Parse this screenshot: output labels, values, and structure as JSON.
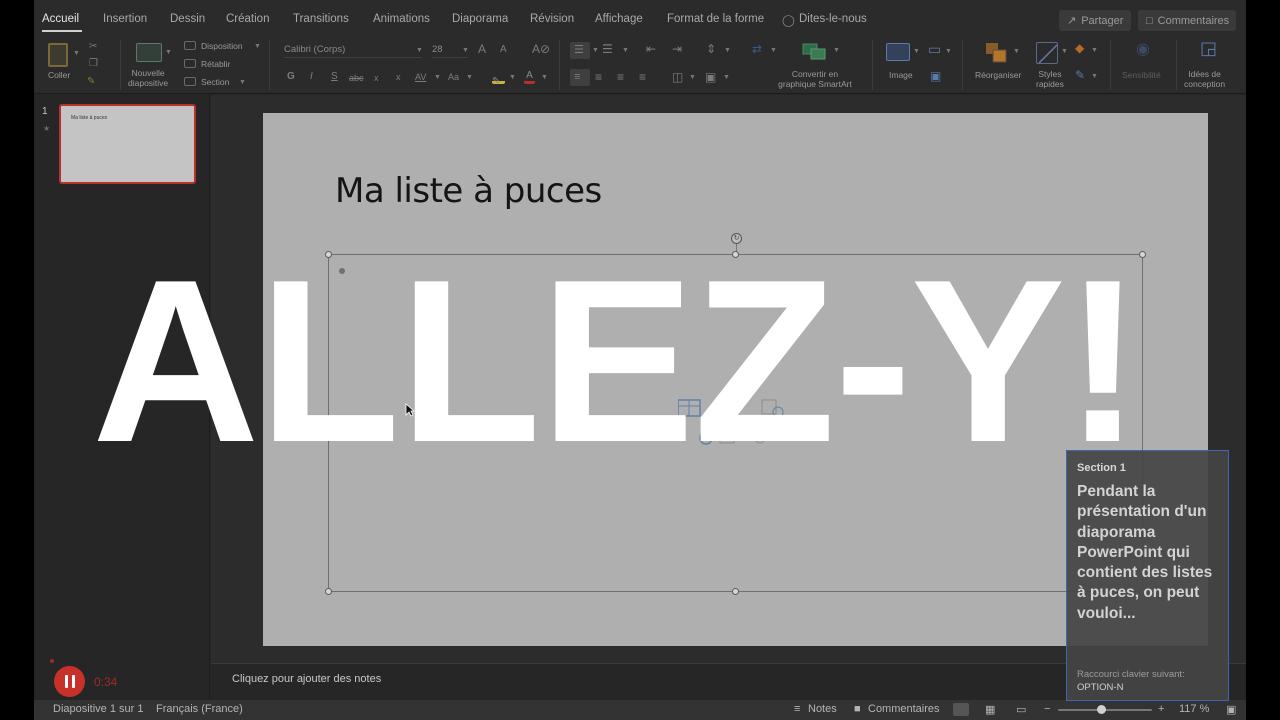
{
  "ribbon_tabs": [
    "Accueil",
    "Insertion",
    "Dessin",
    "Création",
    "Transitions",
    "Animations",
    "Diaporama",
    "Révision",
    "Affichage",
    "Format de la forme",
    "Dites-le-nous"
  ],
  "share_label": "Partager",
  "comments_label": "Commentaires",
  "ribbon": {
    "paste": "Coller",
    "new_slide": "Nouvelle\ndiapositive",
    "layout": "Disposition",
    "reset": "Rétablir",
    "section": "Section",
    "font_name": "Calibri (Corps)",
    "font_size": "28",
    "bold": "G",
    "italic": "I",
    "underline": "S",
    "strikethrough": "abc",
    "subscript": "x",
    "superscript": "x",
    "char_spacing": "AV",
    "change_case": "Aa",
    "smartart": "Convertir en\ngraphique SmartArt",
    "image": "Image",
    "arrange": "Réorganiser",
    "quick_styles": "Styles\nrapides",
    "sensitivity": "Sensibilité",
    "design_ideas": "Idées de\nconception"
  },
  "thumbnail": {
    "number": "1",
    "title": "Ma liste à puces"
  },
  "slide": {
    "title": "Ma liste à puces"
  },
  "notes_placeholder": "Cliquez pour ajouter des notes",
  "status": {
    "slide_info": "Diapositive 1 sur 1",
    "language": "Français (France)",
    "notes": "Notes",
    "comments": "Commentaires",
    "zoom": "117 %"
  },
  "overlay": {
    "big_text": "ALLEZ-Y!",
    "recording_time": "0:34"
  },
  "tooltip": {
    "heading": "Section 1",
    "body": "Pendant la présentation d'un diaporama PowerPoint qui contient des listes à puces, on peut vouloi...",
    "shortcut_label": "Raccourci clavier suivant:",
    "shortcut_key": "OPTION-N"
  },
  "colors": {
    "accent_red": "#c8312a",
    "selection_blue": "#3f66b4",
    "slide_bg": "#afafaf"
  }
}
